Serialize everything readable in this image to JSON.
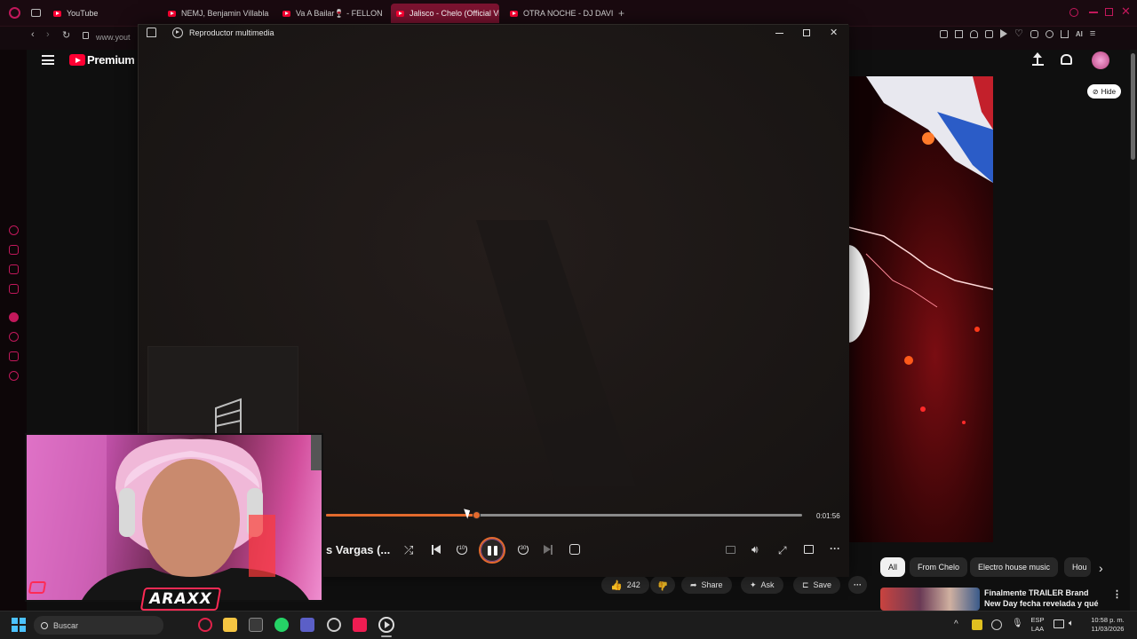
{
  "tabs": [
    {
      "label": "YouTube",
      "active": false
    },
    {
      "label": "NEMJ, Benjamin Villablanc",
      "active": false
    },
    {
      "label": "Va A Bailar🍷 - FELLON",
      "active": false
    },
    {
      "label": "Jalisco - Chelo (Official Vi",
      "active": true
    },
    {
      "label": "OTRA NOCHE - DJ DAVID",
      "active": false
    }
  ],
  "browser": {
    "url": "www.yout"
  },
  "youtube": {
    "logo_text": "Premium",
    "hide_label": "Hide",
    "chips": [
      "All",
      "From Chelo",
      "Electro house music",
      "Hou"
    ],
    "actions": {
      "likes": "242",
      "share": "Share",
      "ask": "Ask",
      "save": "Save"
    },
    "recommendation": {
      "title": "Finalmente TRAILER Brand New Day fecha revelada y qué ..."
    }
  },
  "player": {
    "title": "Reproductor multimedia",
    "track_title": "s Vargas (...",
    "time_end": "0:01:56",
    "progress": 0.315
  },
  "taskbar": {
    "search_placeholder": "Buscar",
    "lang_line1": "ESP",
    "lang_line2": "LAA",
    "time": "10:58 p. m.",
    "date": "11/03/2026"
  },
  "overlay": {
    "logo_text": "ARAXX"
  },
  "colors": {
    "accent": "#e36a2d",
    "browser_accent": "#c2185b",
    "youtube_red": "#ff0033"
  }
}
